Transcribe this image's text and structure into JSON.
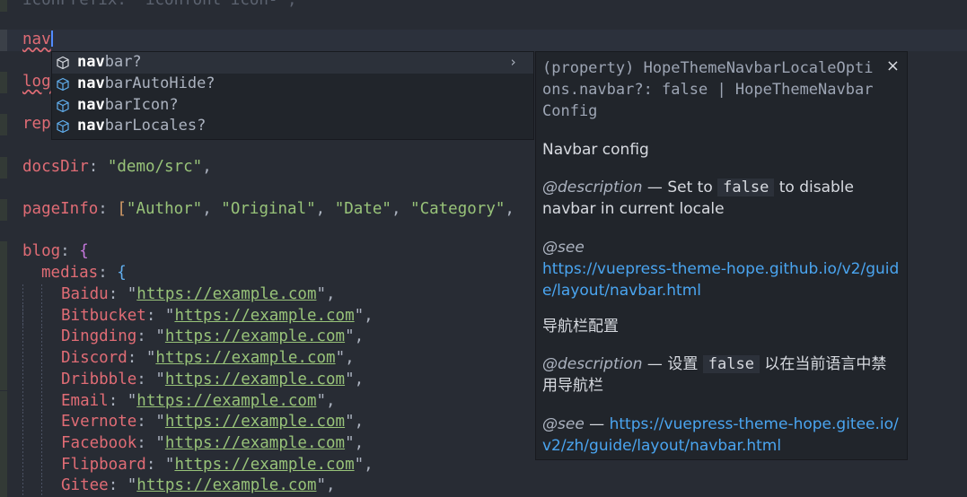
{
  "editor": {
    "lines": [
      {
        "top": "iconPrefix: \"iconfont icon-\","
      },
      {
        "nav": "nav"
      },
      {
        "log": "log"
      },
      {
        "rep": "rep"
      },
      {
        "docs_key": "docsDir",
        "docs_val": "\"demo/src\""
      },
      {
        "page_key": "pageInfo",
        "page_vals": [
          "\"Author\"",
          "\"Original\"",
          "\"Date\"",
          "\"Category\""
        ]
      },
      {
        "blog_key": "blog"
      },
      {
        "medias_key": "medias"
      }
    ],
    "media_entries": [
      {
        "key": "Baidu",
        "url": "https://example.com"
      },
      {
        "key": "Bitbucket",
        "url": "https://example.com"
      },
      {
        "key": "Dingding",
        "url": "https://example.com"
      },
      {
        "key": "Discord",
        "url": "https://example.com"
      },
      {
        "key": "Dribbble",
        "url": "https://example.com"
      },
      {
        "key": "Email",
        "url": "https://example.com"
      },
      {
        "key": "Evernote",
        "url": "https://example.com"
      },
      {
        "key": "Facebook",
        "url": "https://example.com"
      },
      {
        "key": "Flipboard",
        "url": "https://example.com"
      },
      {
        "key": "Gitee",
        "url": "https://example.com"
      }
    ]
  },
  "suggest": {
    "typed": "nav",
    "items": [
      {
        "match": "nav",
        "rest": "bar?",
        "icon": "property-cube-icon"
      },
      {
        "match": "nav",
        "rest": "barAutoHide?",
        "icon": "property-cube-icon"
      },
      {
        "match": "nav",
        "rest": "barIcon?",
        "icon": "property-cube-icon"
      },
      {
        "match": "nav",
        "rest": "barLocales?",
        "icon": "property-cube-icon"
      }
    ],
    "chevron": "›"
  },
  "details": {
    "signature": "(property) HopeThemeNavbarLocaleOptions.navbar?: false | HopeThemeNavbarConfig",
    "close": "×",
    "summary_en": "Navbar config",
    "desc_tag": "@description",
    "desc_en_pre": " — Set to ",
    "desc_en_code": "false",
    "desc_en_post": " to disable navbar in current locale",
    "see_tag": "@see",
    "see_en_url": "https://vuepress-theme-hope.github.io/v2/guide/layout/navbar.html",
    "summary_zh": "导航栏配置",
    "desc_zh_pre": " — 设置 ",
    "desc_zh_code": "false",
    "desc_zh_post": " 以在当前语言中禁用导航栏",
    "see_zh_sep": " — ",
    "see_zh_url": "https://vuepress-theme-hope.gitee.io/v2/zh/guide/layout/navbar.html"
  },
  "colors": {
    "background": "#282c34",
    "key": "#e06c75",
    "string": "#98c379",
    "link": "#4aa5f0"
  }
}
